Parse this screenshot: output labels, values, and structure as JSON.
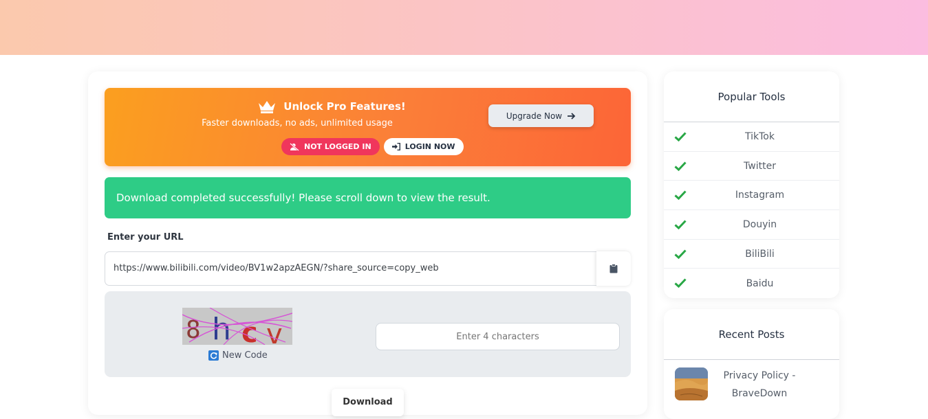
{
  "pro_banner": {
    "title": "Unlock Pro Features!",
    "subtitle": "Faster downloads, no ads, unlimited usage",
    "status_badge": "NOT LOGGED IN",
    "login_button": "LOGIN NOW",
    "upgrade_button": "Upgrade Now",
    "gradient_start": "#fb9f1f",
    "gradient_end": "#fc6537"
  },
  "alert": {
    "message": "Download completed successfully! Please scroll down to view the result.",
    "color": "#2ecc86"
  },
  "url_form": {
    "label": "Enter your URL",
    "value": "https://www.bilibili.com/video/BV1w2apzAEGN/?share_source=copy_web"
  },
  "captcha": {
    "new_code_label": "New Code",
    "input_placeholder": "Enter 4 characters",
    "characters": [
      "8",
      "h",
      "c",
      "v"
    ]
  },
  "download_button": "Download",
  "popular_tools": {
    "title": "Popular Tools",
    "items": [
      {
        "label": "TikTok"
      },
      {
        "label": "Twitter"
      },
      {
        "label": "Instagram"
      },
      {
        "label": "Douyin"
      },
      {
        "label": "BiliBili"
      },
      {
        "label": "Baidu"
      }
    ],
    "check_color": "#28a745"
  },
  "recent_posts": {
    "title": "Recent Posts",
    "items": [
      {
        "title": "Privacy Policy - BraveDown"
      }
    ]
  }
}
